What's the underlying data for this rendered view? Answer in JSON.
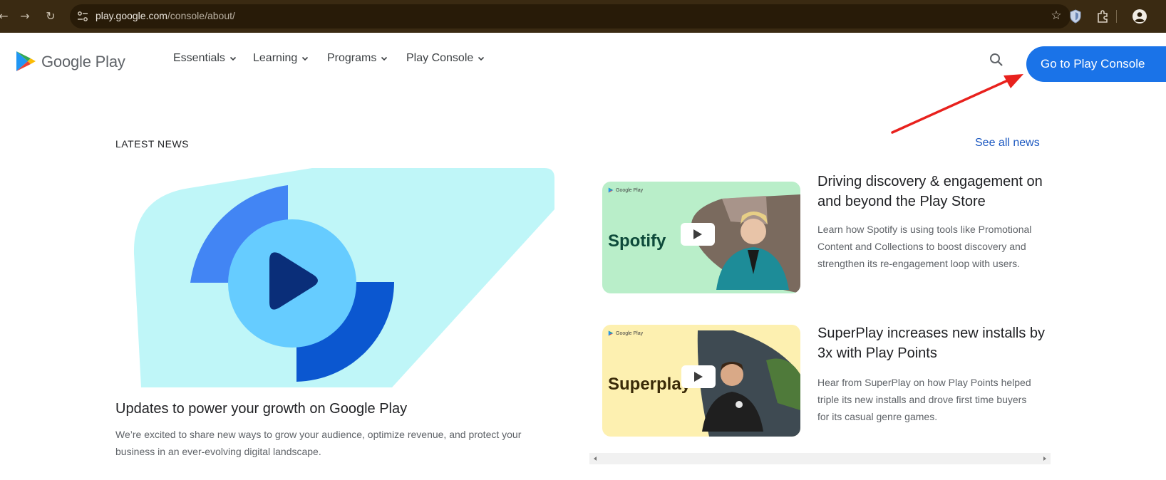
{
  "browser": {
    "url_host": "play.google.com",
    "url_path": "/console/about/"
  },
  "site": {
    "brand": "Google Play",
    "nav": [
      {
        "label": "Essentials"
      },
      {
        "label": "Learning"
      },
      {
        "label": "Programs"
      },
      {
        "label": "Play Console"
      }
    ],
    "cta_label": "Go to Play Console"
  },
  "news": {
    "section_label": "LATEST NEWS",
    "see_all_label": "See all news",
    "featured": {
      "title": "Updates to power your growth on Google Play",
      "description": "We’re excited to share new ways to grow your audience, optimize revenue, and protect your business in an ever-evolving digital landscape."
    },
    "cards": [
      {
        "thumb_logo": "Google Play",
        "thumb_brand": "Spotify",
        "thumb_bg": "#b9eec9",
        "title": "Driving discovery & engagement on and beyond the Play Store",
        "description": "Learn how Spotify is using tools like Promotional Content and Collections to boost discovery and strengthen its re-engagement loop with users."
      },
      {
        "thumb_logo": "Google Play",
        "thumb_brand": "Superplay",
        "thumb_bg": "#fdf0b0",
        "title": "SuperPlay increases new installs by 3x with Play Points",
        "description": "Hear from SuperPlay on how Play Points helped triple its new installs and drove first time buyers for its casual genre games."
      }
    ]
  },
  "colors": {
    "accent": "#1a73e8",
    "annotation": "#e8211d"
  }
}
